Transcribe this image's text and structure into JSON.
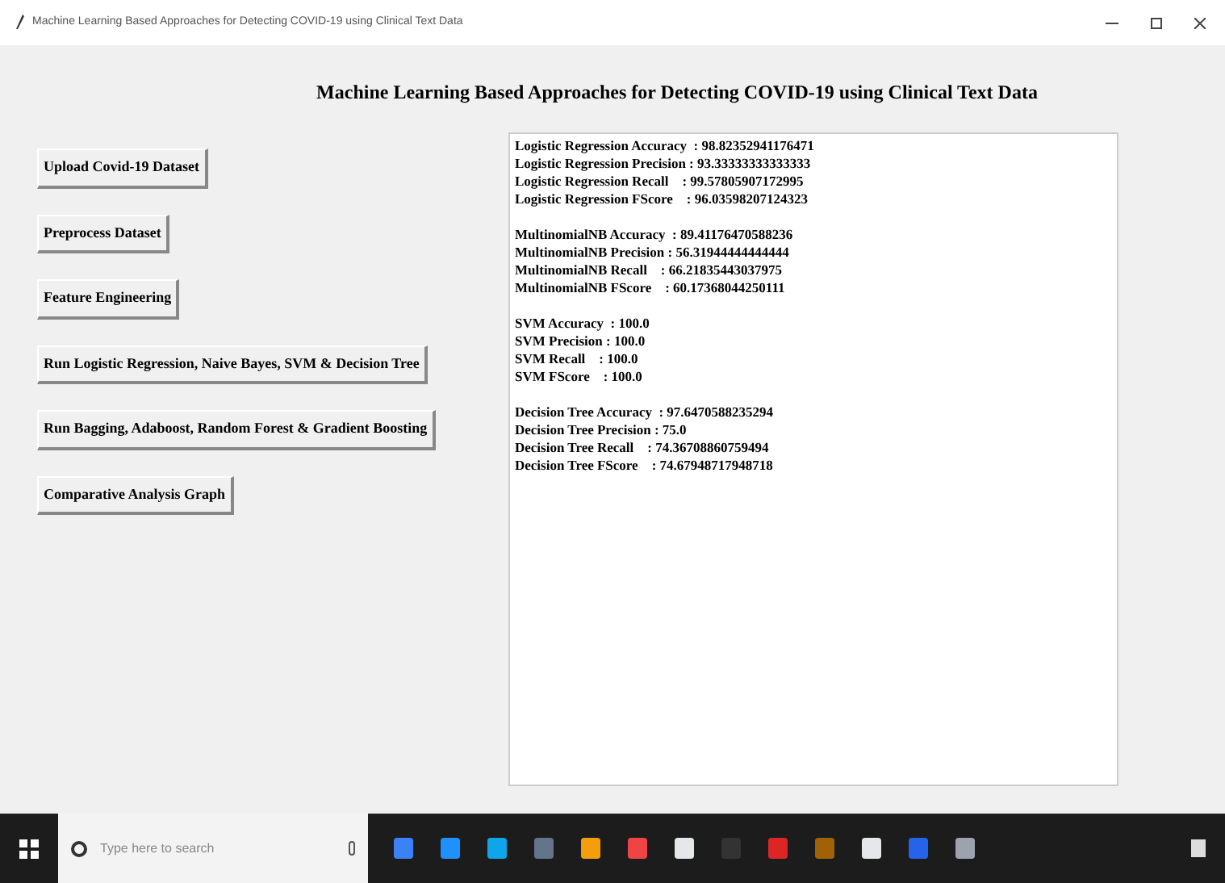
{
  "window": {
    "title": "Machine Learning Based Approaches for Detecting COVID-19 using Clinical Text Data"
  },
  "heading": "Machine Learning Based Approaches for Detecting COVID-19 using Clinical Text Data",
  "buttons": [
    "Upload Covid-19 Dataset",
    "Preprocess Dataset",
    "Feature Engineering",
    "Run Logistic Regression, Naive Bayes, SVM & Decision Tree",
    "Run Bagging, Adaboost, Random Forest & Gradient Boosting",
    "Comparative Analysis Graph"
  ],
  "output": [
    [
      "Logistic Regression Accuracy  : 98.82352941176471",
      "Logistic Regression Precision : 93.33333333333333",
      "Logistic Regression Recall    : 99.57805907172995",
      "Logistic Regression FScore    : 96.03598207124323"
    ],
    [
      "MultinomialNB Accuracy  : 89.41176470588236",
      "MultinomialNB Precision : 56.31944444444444",
      "MultinomialNB Recall    : 66.21835443037975",
      "MultinomialNB FScore    : 60.17368044250111"
    ],
    [
      "SVM Accuracy  : 100.0",
      "SVM Precision : 100.0",
      "SVM Recall    : 100.0",
      "SVM FScore    : 100.0"
    ],
    [
      "Decision Tree Accuracy  : 97.6470588235294",
      "Decision Tree Precision : 75.0",
      "Decision Tree Recall    : 74.36708860759494",
      "Decision Tree FScore    : 74.67948717948718"
    ]
  ],
  "taskbar": {
    "search_placeholder": "Type here to search"
  }
}
